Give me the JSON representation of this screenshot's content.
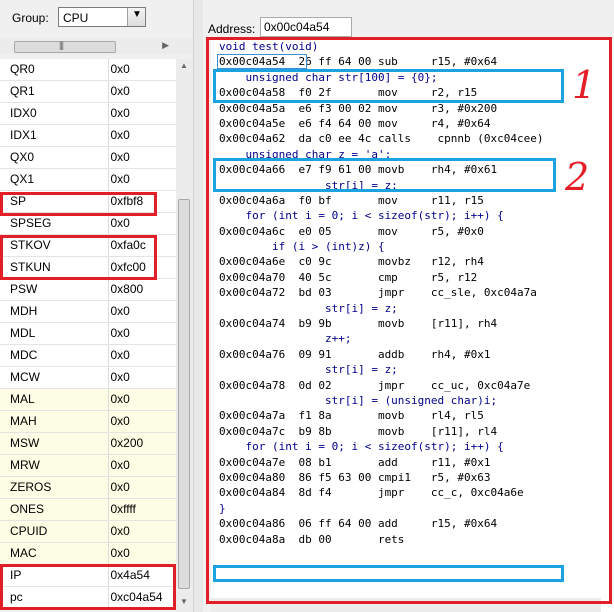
{
  "group": {
    "label": "Group:",
    "selected": "CPU",
    "dropdown_arrow": "chevron-down-icon"
  },
  "address": {
    "label": "Address:",
    "value": "0x00c04a54"
  },
  "registers": [
    {
      "name": "QR0",
      "value": "0x0"
    },
    {
      "name": "QR1",
      "value": "0x0"
    },
    {
      "name": "IDX0",
      "value": "0x0"
    },
    {
      "name": "IDX1",
      "value": "0x0"
    },
    {
      "name": "QX0",
      "value": "0x0"
    },
    {
      "name": "QX1",
      "value": "0x0"
    },
    {
      "name": "SP",
      "value": "0xfbf8"
    },
    {
      "name": "SPSEG",
      "value": "0x0"
    },
    {
      "name": "STKOV",
      "value": "0xfa0c"
    },
    {
      "name": "STKUN",
      "value": "0xfc00"
    },
    {
      "name": "PSW",
      "value": "0x800"
    },
    {
      "name": "MDH",
      "value": "0x0"
    },
    {
      "name": "MDL",
      "value": "0x0"
    },
    {
      "name": "MDC",
      "value": "0x0"
    },
    {
      "name": "MCW",
      "value": "0x0"
    },
    {
      "name": "MAL",
      "value": "0x0"
    },
    {
      "name": "MAH",
      "value": "0x0"
    },
    {
      "name": "MSW",
      "value": "0x200"
    },
    {
      "name": "MRW",
      "value": "0x0"
    },
    {
      "name": "ZEROS",
      "value": "0x0"
    },
    {
      "name": "ONES",
      "value": "0xffff"
    },
    {
      "name": "CPUID",
      "value": "0x0"
    },
    {
      "name": "MAC",
      "value": "0x0"
    },
    {
      "name": "IP",
      "value": "0x4a54"
    },
    {
      "name": "pc",
      "value": "0xc04a54"
    }
  ],
  "disassembly": [
    {
      "kind": "src",
      "text": "void test(void)"
    },
    {
      "kind": "asm",
      "text": "0x00c04a54  26 ff 64 00 sub     r15, #0x64"
    },
    {
      "kind": "src",
      "text": "    unsigned char str[100] = {0};"
    },
    {
      "kind": "asm",
      "text": "0x00c04a58  f0 2f       mov     r2, r15"
    },
    {
      "kind": "asm",
      "text": "0x00c04a5a  e6 f3 00 02 mov     r3, #0x200"
    },
    {
      "kind": "asm",
      "text": "0x00c04a5e  e6 f4 64 00 mov     r4, #0x64"
    },
    {
      "kind": "asm",
      "text": "0x00c04a62  da c0 ee 4c calls    cpnnb (0xc04cee)"
    },
    {
      "kind": "src",
      "text": "    unsigned char z = 'a';"
    },
    {
      "kind": "asm",
      "text": "0x00c04a66  e7 f9 61 00 movb    rh4, #0x61"
    },
    {
      "kind": "src",
      "text": "                str[i] = z;"
    },
    {
      "kind": "asm",
      "text": "0x00c04a6a  f0 bf       mov     r11, r15"
    },
    {
      "kind": "src",
      "text": "    for (int i = 0; i < sizeof(str); i++) {"
    },
    {
      "kind": "asm",
      "text": "0x00c04a6c  e0 05       mov     r5, #0x0"
    },
    {
      "kind": "src",
      "text": "        if (i > (int)z) {"
    },
    {
      "kind": "asm",
      "text": "0x00c04a6e  c0 9c       movbz   r12, rh4"
    },
    {
      "kind": "asm",
      "text": "0x00c04a70  40 5c       cmp     r5, r12"
    },
    {
      "kind": "asm",
      "text": "0x00c04a72  bd 03       jmpr    cc_sle, 0xc04a7a"
    },
    {
      "kind": "src",
      "text": "                str[i] = z;"
    },
    {
      "kind": "asm",
      "text": "0x00c04a74  b9 9b       movb    [r11], rh4"
    },
    {
      "kind": "src",
      "text": "                z++;"
    },
    {
      "kind": "asm",
      "text": "0x00c04a76  09 91       addb    rh4, #0x1"
    },
    {
      "kind": "src",
      "text": "                str[i] = z;"
    },
    {
      "kind": "asm",
      "text": "0x00c04a78  0d 02       jmpr    cc_uc, 0xc04a7e"
    },
    {
      "kind": "src",
      "text": "                str[i] = (unsigned char)i;"
    },
    {
      "kind": "asm",
      "text": "0x00c04a7a  f1 8a       movb    rl4, rl5"
    },
    {
      "kind": "asm",
      "text": "0x00c04a7c  b9 8b       movb    [r11], rl4"
    },
    {
      "kind": "src",
      "text": "    for (int i = 0; i < sizeof(str); i++) {"
    },
    {
      "kind": "asm",
      "text": "0x00c04a7e  08 b1       add     r11, #0x1"
    },
    {
      "kind": "asm",
      "text": "0x00c04a80  86 f5 63 00 cmpi1   r5, #0x63"
    },
    {
      "kind": "asm",
      "text": "0x00c04a84  8d f4       jmpr    cc_c, 0xc04a6e"
    },
    {
      "kind": "src",
      "text": "}"
    },
    {
      "kind": "asm",
      "text": "0x00c04a86  06 ff 64 00 add     r15, #0x64"
    },
    {
      "kind": "asm",
      "text": "0x00c04a8a  db 00       rets"
    }
  ],
  "annotations": {
    "one": "1",
    "two": "2"
  },
  "colors": {
    "red": "#e41e26",
    "blue": "#1aa3e0",
    "source_text": "#00008b",
    "highlight_row": "#fdfde6"
  }
}
